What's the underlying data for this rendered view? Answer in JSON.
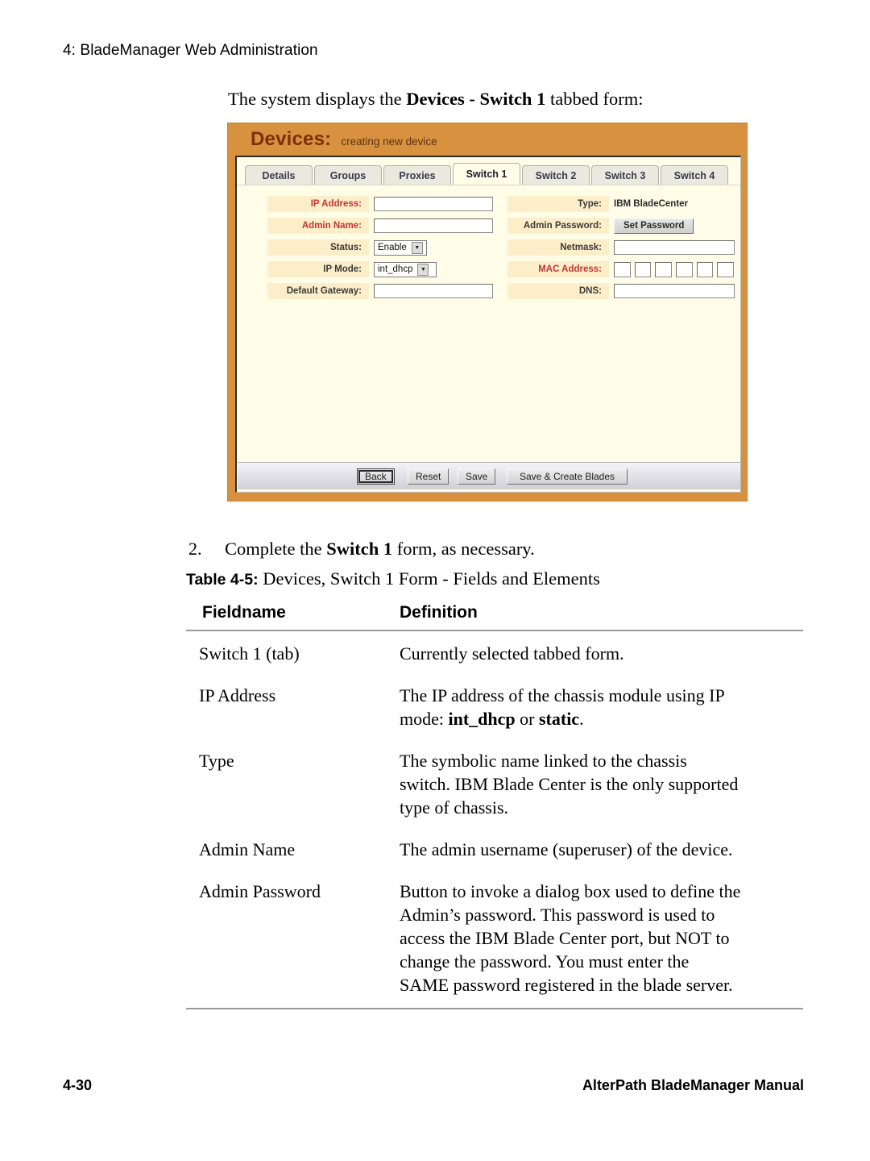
{
  "page": {
    "running_header": "4: BladeManager Web Administration",
    "footer_page_number": "4-30",
    "footer_title": "AlterPath BladeManager Manual"
  },
  "intro": {
    "before": "The system displays the ",
    "bold": "Devices - Switch 1",
    "after": " tabbed form:"
  },
  "screenshot": {
    "title": "Devices:",
    "subtitle": "creating new device",
    "tabs": [
      {
        "label": "Details",
        "active": false
      },
      {
        "label": "Groups",
        "active": false
      },
      {
        "label": "Proxies",
        "active": false
      },
      {
        "label": "Switch 1",
        "active": true
      },
      {
        "label": "Switch 2",
        "active": false
      },
      {
        "label": "Switch 3",
        "active": false
      },
      {
        "label": "Switch 4",
        "active": false
      }
    ],
    "left_fields": [
      {
        "label": "IP Address:",
        "required": true,
        "control": "text",
        "value": ""
      },
      {
        "label": "Admin Name:",
        "required": true,
        "control": "text",
        "value": ""
      },
      {
        "label": "Status:",
        "required": false,
        "control": "select",
        "value": "Enable"
      },
      {
        "label": "IP Mode:",
        "required": false,
        "control": "select",
        "value": "int_dhcp"
      },
      {
        "label": "Default Gateway:",
        "required": false,
        "control": "text",
        "value": ""
      }
    ],
    "right_fields": [
      {
        "label": "Type:",
        "required": false,
        "control": "static",
        "value": "IBM BladeCenter"
      },
      {
        "label": "Admin Password:",
        "required": false,
        "control": "button",
        "value": "Set Password"
      },
      {
        "label": "Netmask:",
        "required": false,
        "control": "text",
        "value": ""
      },
      {
        "label": "MAC Address:",
        "required": true,
        "control": "mac",
        "value": ""
      },
      {
        "label": "DNS:",
        "required": false,
        "control": "text",
        "value": ""
      }
    ],
    "mac_octet_count": 6,
    "buttons": [
      {
        "label": "Back",
        "focused": true
      },
      {
        "label": "Reset",
        "focused": false
      },
      {
        "label": "Save",
        "focused": false
      },
      {
        "label": "Save & Create Blades",
        "focused": false
      }
    ],
    "colors": {
      "header_orange": "#d8913f",
      "title_brown": "#7d2f09",
      "panel_cream": "#fffde8",
      "label_cream": "#fdeeca",
      "required_red": "#c23434"
    }
  },
  "step": {
    "number": "2.",
    "before": "Complete the ",
    "bold": "Switch 1",
    "after": " form, as necessary."
  },
  "table_caption": {
    "label": "Table 4-5:",
    "text": " Devices, Switch 1 Form - Fields and Elements"
  },
  "table": {
    "headers": {
      "fieldname": "Fieldname",
      "definition": "Definition"
    },
    "rows": [
      {
        "fieldname": "Switch 1 (tab)",
        "lines": [
          [
            {
              "t": "Currently selected tabbed form.",
              "b": false
            }
          ]
        ]
      },
      {
        "fieldname": "IP Address",
        "lines": [
          [
            {
              "t": "The IP address of the chassis module using IP",
              "b": false
            }
          ],
          [
            {
              "t": "mode: ",
              "b": false
            },
            {
              "t": "int_dhcp",
              "b": true
            },
            {
              "t": " or ",
              "b": false
            },
            {
              "t": "static",
              "b": true
            },
            {
              "t": ".",
              "b": false
            }
          ]
        ]
      },
      {
        "fieldname": "Type",
        "lines": [
          [
            {
              "t": "The symbolic name linked to the chassis",
              "b": false
            }
          ],
          [
            {
              "t": "switch. IBM Blade Center is the only supported",
              "b": false
            }
          ],
          [
            {
              "t": "type of chassis.",
              "b": false
            }
          ]
        ]
      },
      {
        "fieldname": "Admin Name",
        "lines": [
          [
            {
              "t": "The admin username (superuser) of the device.",
              "b": false
            }
          ]
        ]
      },
      {
        "fieldname": "Admin Password",
        "lines": [
          [
            {
              "t": "Button to invoke a dialog box used to define the",
              "b": false
            }
          ],
          [
            {
              "t": "Admin’s password. This password is used to",
              "b": false
            }
          ],
          [
            {
              "t": "access the IBM Blade Center port, but NOT to",
              "b": false
            }
          ],
          [
            {
              "t": "change the password. You must enter the",
              "b": false
            }
          ],
          [
            {
              "t": "SAME password registered in the blade server.",
              "b": false
            }
          ]
        ]
      }
    ]
  }
}
